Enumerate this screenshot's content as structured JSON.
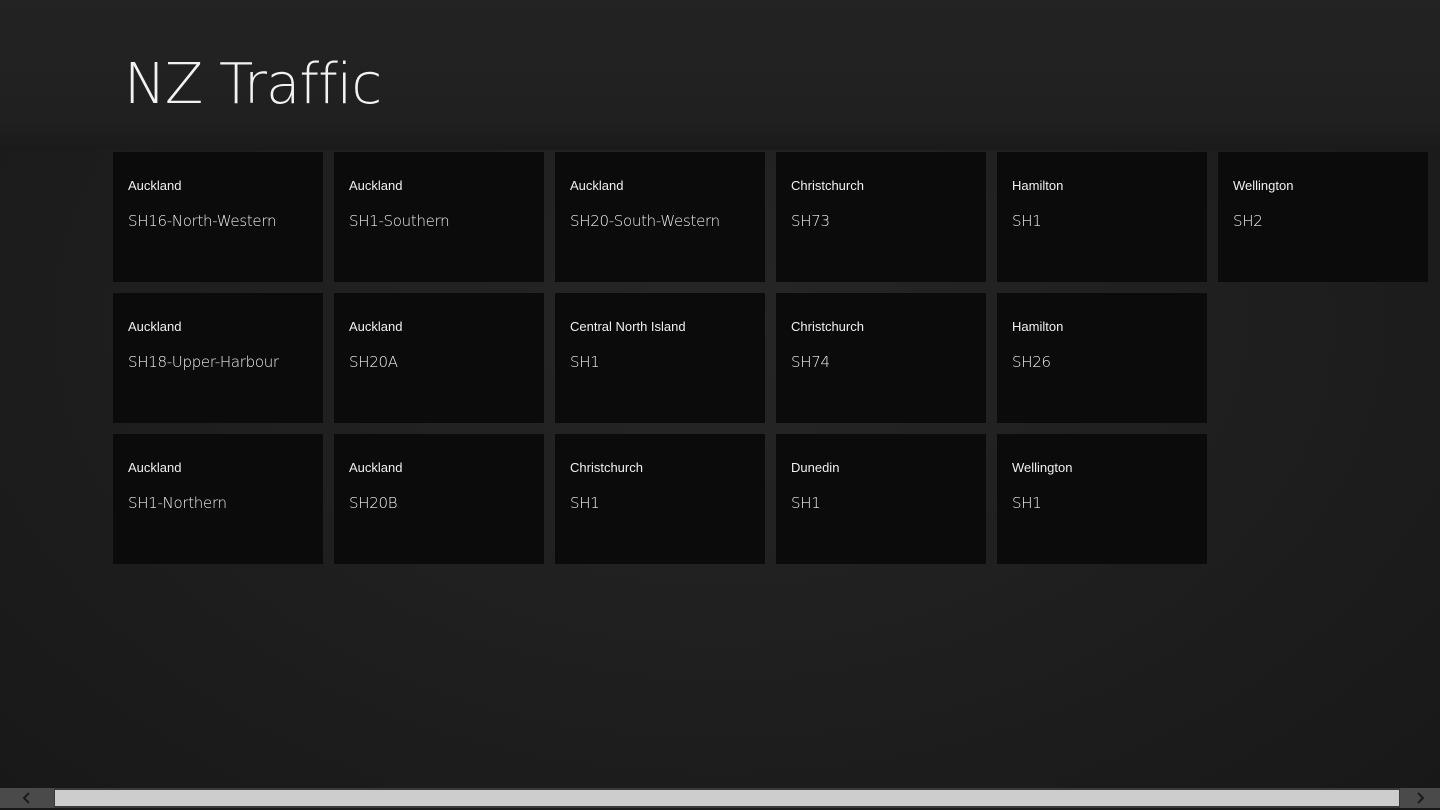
{
  "app": {
    "title": "NZ Traffic"
  },
  "tiles": [
    {
      "region": "Auckland",
      "road": "SH16-North-Western"
    },
    {
      "region": "Auckland",
      "road": "SH18-Upper-Harbour"
    },
    {
      "region": "Auckland",
      "road": "SH1-Northern"
    },
    {
      "region": "Auckland",
      "road": "SH1-Southern"
    },
    {
      "region": "Auckland",
      "road": "SH20A"
    },
    {
      "region": "Auckland",
      "road": "SH20B"
    },
    {
      "region": "Auckland",
      "road": "SH20-South-Western"
    },
    {
      "region": "Central North Island",
      "road": "SH1"
    },
    {
      "region": "Christchurch",
      "road": "SH1"
    },
    {
      "region": "Christchurch",
      "road": "SH73"
    },
    {
      "region": "Christchurch",
      "road": "SH74"
    },
    {
      "region": "Dunedin",
      "road": "SH1"
    },
    {
      "region": "Hamilton",
      "road": "SH1"
    },
    {
      "region": "Hamilton",
      "road": "SH26"
    },
    {
      "region": "Wellington",
      "road": "SH1"
    },
    {
      "region": "Wellington",
      "road": "SH2"
    }
  ],
  "scrollbar": {
    "left_icon": "chevron-left-icon",
    "right_icon": "chevron-right-icon"
  },
  "colors": {
    "background": "#1e1e1e",
    "tile": "#0b0b0b",
    "text": "#f0f0f0",
    "scroll_thumb": "#cdcdcd"
  }
}
